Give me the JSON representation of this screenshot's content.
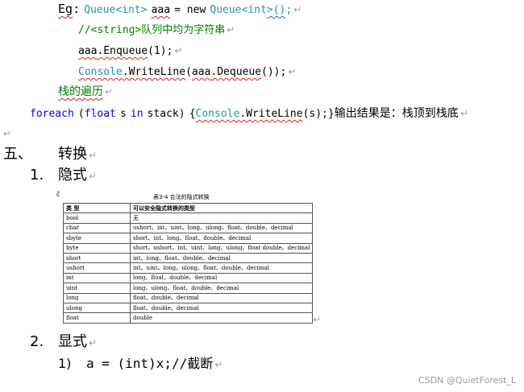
{
  "code": {
    "eg_label": "Eg",
    "eg_colon": ":",
    "eg_queue_decl": {
      "t1": "Queue<int>",
      "var": "aaa",
      "eq_new": "= new",
      "t2": "Queue<int",
      "gt_paren": ">()",
      "semi": ";"
    },
    "comment": "//<string>队列中均为字符串",
    "enqueue": {
      "obj": "aaa",
      "method": ".Enqueue",
      "args": "(1)",
      "semi": ";"
    },
    "writeline": {
      "cls": "Console",
      "method": ".WriteLine",
      "open": "(",
      "obj": "aaa",
      "deq": ".Dequeue",
      "close": "());"
    },
    "stack_label": "栈的遍历",
    "foreach": {
      "kw_foreach": "foreach",
      "open": "(",
      "kw_float": "float",
      "var": "s",
      "kw_in": "in",
      "col": "stack)",
      "brace_open": "{",
      "cls": "Console",
      "method": ".WriteLine",
      "rest": "(s);}",
      "note": "输出结果是：栈顶到栈底"
    }
  },
  "sections": {
    "five_num": "五、",
    "five_title": "转换",
    "one_num": "1.",
    "one_title": "隐式",
    "two_num": "2.",
    "two_title": "显式",
    "sub1_num": "1)",
    "sub1_code": "a = (int)x;//截断"
  },
  "table": {
    "mark": "č",
    "caption": "表3-4  合法的隐式转换",
    "headers": [
      "类  型",
      "可以安全隐式转换的类型"
    ],
    "rows": [
      [
        "bool",
        "无"
      ],
      [
        "char",
        "ushort、int、uint、long、ulong、float、double、decimal"
      ],
      [
        "sbyte",
        "short、int、long、float、double、decimal"
      ],
      [
        "byte",
        "short、ushort、int、uint、long、ulong、float double、decimal"
      ],
      [
        "short",
        "int、long、float、double、decimal"
      ],
      [
        "ushort",
        "int、uint、long、ulong、float、double、decimal"
      ],
      [
        "int",
        "long、float、double、decimal"
      ],
      [
        "uint",
        "long、ulong、float、double、decimal"
      ],
      [
        "long",
        "float、double、decimal"
      ],
      [
        "ulong",
        "float、double、decimal"
      ],
      [
        "float",
        "double"
      ]
    ]
  },
  "paragraph_mark": "↵",
  "watermark": "CSDN @QuietForest_L"
}
